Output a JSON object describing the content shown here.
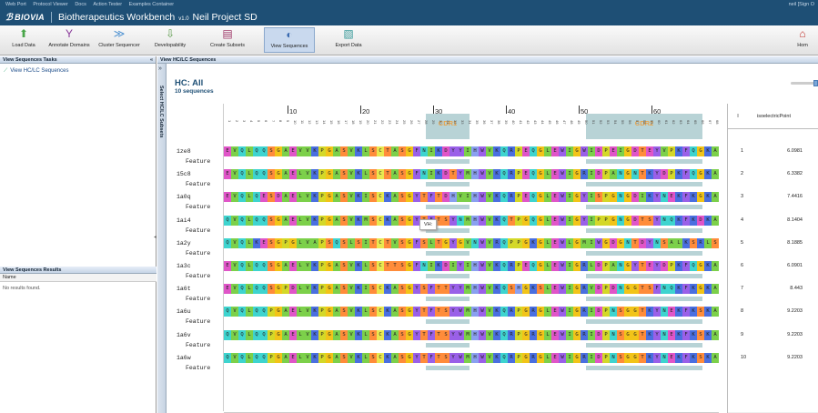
{
  "topnav": {
    "links": [
      "Web Port",
      "Protocol Viewer",
      "Docs",
      "Action Tester",
      "Examples Container"
    ],
    "user": "neil [Sign O"
  },
  "app": {
    "brand": "BIOVIA",
    "title": "Biotherapeutics Workbench",
    "version": "v1.0",
    "project": "Neil Project SD"
  },
  "toolbar": {
    "buttons": [
      {
        "label": "Load Data",
        "icon": "load-data-icon",
        "color": "#4aa64a",
        "glyph": "⬆"
      },
      {
        "label": "Annotate Domains",
        "icon": "annotate-domains-icon",
        "color": "#8a3a9a",
        "glyph": "Y"
      },
      {
        "label": "Cluster Sequencer",
        "icon": "cluster-sequencer-icon",
        "color": "#4a8fd0",
        "glyph": "≫"
      },
      {
        "label": "Developability",
        "icon": "developability-icon",
        "color": "#5a9a4a",
        "glyph": "⇩"
      },
      {
        "label": "Create Subsets",
        "icon": "create-subsets-icon",
        "color": "#a03a6a",
        "glyph": "▤"
      },
      {
        "label": "View Sequences",
        "icon": "view-sequences-icon",
        "color": "#3a6ab0",
        "glyph": "◐"
      },
      {
        "label": "Export Data",
        "icon": "export-data-icon",
        "color": "#3a9a9a",
        "glyph": "▧"
      },
      {
        "label": "Hom",
        "icon": "home-icon",
        "color": "#c0302a",
        "glyph": "⌂"
      }
    ]
  },
  "left": {
    "tasks_header": "View Sequences Tasks",
    "task_item": "View HC/LC Sequences",
    "results_header": "View Sequences Results",
    "name_col": "Name",
    "no_results": "No results found."
  },
  "main": {
    "header": "View HC/LC Sequences",
    "side_label": "Select HC/LC Subsets",
    "title": "HC: All",
    "subtitle": "10 sequences",
    "feature_label": "Feature",
    "tooltip": "VH:"
  },
  "ruler": {
    "ticks": [
      "10",
      "20",
      "30",
      "40",
      "50",
      "60",
      "70"
    ],
    "cdrs": [
      "CDR1",
      "CDR2"
    ]
  },
  "sequences": [
    {
      "id": "1ze8",
      "seq": "EVQLQQSGAEVVKPGASVKLSCTASGFNIKDYYIHWVKQRPEQGLEWIGWIDPEIGDTEYVPKFQGKATMTADTSS"
    },
    {
      "id": "15c8",
      "seq": "EVQLQQSGAELVKPGASVKLSCTASGFNIKDTYMHWVKQRPEQGLEWIGRIDPANGNTKYDPKFQGKATITADTSS"
    },
    {
      "id": "1a0q",
      "seq": "EVQLQESDAELVKPGASVKISCKASGYTFTDHVIHWVKQRPEQGLEWIGYISPGNGDIKYNEKFKGKATLTADKSS"
    },
    {
      "id": "1ai4",
      "seq": "QVQLQQSGAELVKPGASVKMSCKASGYTFTSYNMHWVKQTPGQGLEWIGYIPPGNGDTSYNQKFKDKATLTADKSS"
    },
    {
      "id": "1a2y",
      "seq": "QVQLKESGPGLVAPSQSLSITCTVSGFSLTGYGVNWVRQPPGKGLEWLGMIWGDGNTDYNSALKSRLSISKDNSKS"
    },
    {
      "id": "1a3c",
      "seq": "EVQLQQSGAELVKPGASVKLSCTTSGFNIKDIYIHWVKQRPEQGLEWIGRLDPANGYTEYDPKFQGKATITVDTSS"
    },
    {
      "id": "1a6t",
      "seq": "EVQLQQSGPDLVKPGASVKISCKASGYSFTTYYMHWVKQSHGKSLEWIGRVDPDNGGTSFNQKFKGKAILTVDKSS"
    },
    {
      "id": "1a6u",
      "seq": "QVQLQQPGAELVKPGASVKLSCKASGYTFTSYWMHWVKQRPGRGLEWIGRIDPNSGGTKYNEKFKSKATLTVDKPS"
    },
    {
      "id": "1a6v",
      "seq": "QVQLQQPGAELVKPGASVKLSCKASGYTFTSYWMHWVKQRPGRGLEWIGRIDPNSGGTKYNEKFKSKATLTVDKPS"
    },
    {
      "id": "1a6w",
      "seq": "QVQLQQPGAELVKPGASVKLSCKASGYTFTSYWMHWVKQRPGRGLEWIGRIDPNSGGTKYNEKFKSKATLTVDKPS"
    }
  ],
  "grid": {
    "col_index": "I",
    "col_name": "isoelectricPoint",
    "rows": [
      {
        "n": "1",
        "v": "6.0981"
      },
      {
        "n": "2",
        "v": "6.3382"
      },
      {
        "n": "3",
        "v": "7.4416"
      },
      {
        "n": "4",
        "v": "8.1404"
      },
      {
        "n": "5",
        "v": "8.1885"
      },
      {
        "n": "6",
        "v": "6.0901"
      },
      {
        "n": "7",
        "v": "8.443"
      },
      {
        "n": "8",
        "v": "9.2203"
      },
      {
        "n": "9",
        "v": "9.2203"
      },
      {
        "n": "10",
        "v": "9.2203"
      }
    ]
  },
  "colors": {
    "topbar": "#1e4f75",
    "cdr": "#b8d3d6",
    "cdr_text": "#e8a54d"
  },
  "residue_colors": {
    "E": "#e055c8",
    "D": "#e055c8",
    "V": "#7cd04a",
    "I": "#7cd04a",
    "L": "#7cd04a",
    "M": "#7cd04a",
    "A": "#7cd04a",
    "Q": "#3ed4cf",
    "N": "#3ed4cf",
    "S": "#ff8c3a",
    "T": "#ff8c3a",
    "G": "#f2c418",
    "P": "#d4d828",
    "K": "#4a6fe0",
    "R": "#4a6fe0",
    "H": "#8aa0f0",
    "C": "#e8e850",
    "W": "#9a60e8",
    "F": "#9a60e8",
    "Y": "#9a60e8"
  }
}
